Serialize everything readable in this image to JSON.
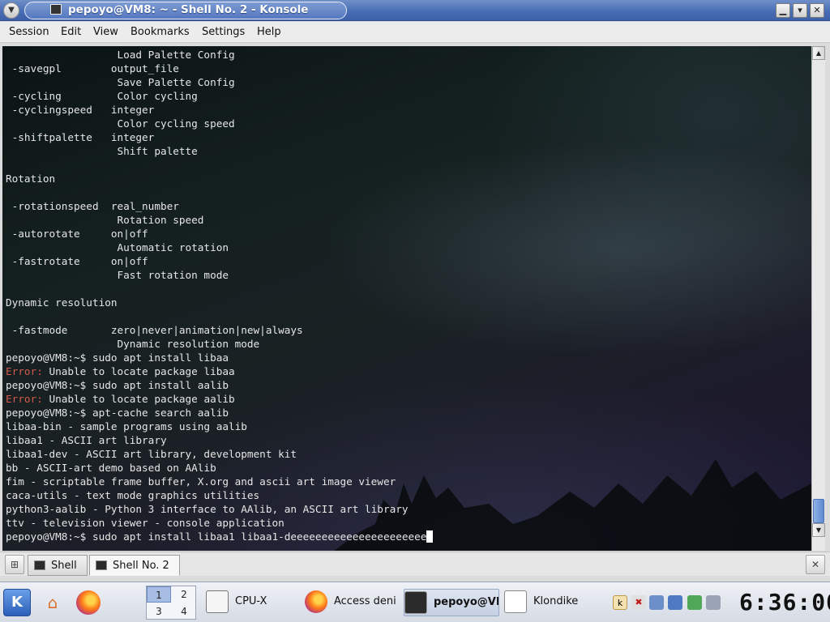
{
  "window": {
    "title": "pepoyo@VM8: ~ - Shell No. 2 - Konsole",
    "controls": {
      "minimize": "▁",
      "maximize": "▾",
      "close": "✕"
    }
  },
  "menubar": [
    "Session",
    "Edit",
    "View",
    "Bookmarks",
    "Settings",
    "Help"
  ],
  "terminal": {
    "lines": [
      {
        "text": "                  Load Palette Config"
      },
      {
        "text": " -savegpl        output_file"
      },
      {
        "text": "                  Save Palette Config"
      },
      {
        "text": " -cycling         Color cycling"
      },
      {
        "text": " -cyclingspeed   integer"
      },
      {
        "text": "                  Color cycling speed"
      },
      {
        "text": " -shiftpalette   integer"
      },
      {
        "text": "                  Shift palette"
      },
      {
        "text": ""
      },
      {
        "text": "Rotation"
      },
      {
        "text": ""
      },
      {
        "text": " -rotationspeed  real_number"
      },
      {
        "text": "                  Rotation speed"
      },
      {
        "text": " -autorotate     on|off"
      },
      {
        "text": "                  Automatic rotation"
      },
      {
        "text": " -fastrotate     on|off"
      },
      {
        "text": "                  Fast rotation mode"
      },
      {
        "text": ""
      },
      {
        "text": "Dynamic resolution"
      },
      {
        "text": ""
      },
      {
        "text": " -fastmode       zero|never|animation|new|always"
      },
      {
        "text": "                  Dynamic resolution mode"
      },
      {
        "text": "pepoyo@VM8:~$ sudo apt install libaa"
      },
      {
        "error": "Error:",
        "text": " Unable to locate package libaa"
      },
      {
        "text": "pepoyo@VM8:~$ sudo apt install aalib"
      },
      {
        "error": "Error:",
        "text": " Unable to locate package aalib"
      },
      {
        "text": "pepoyo@VM8:~$ apt-cache search aalib"
      },
      {
        "text": "libaa-bin - sample programs using aalib"
      },
      {
        "text": "libaa1 - ASCII art library"
      },
      {
        "text": "libaa1-dev - ASCII art library, development kit"
      },
      {
        "text": "bb - ASCII-art demo based on AAlib"
      },
      {
        "text": "fim - scriptable frame buffer, X.org and ascii art image viewer"
      },
      {
        "text": "caca-utils - text mode graphics utilities"
      },
      {
        "text": "python3-aalib - Python 3 interface to AAlib, an ASCII art library"
      },
      {
        "text": "ttv - television viewer - console application"
      },
      {
        "text": "pepoyo@VM8:~$ sudo apt install libaa1 libaa1-deeeeeeeeeeeeeeeeeeeeee",
        "cursor": true
      }
    ]
  },
  "scrollbar": {
    "up": "▲",
    "down": "▼"
  },
  "tabs": {
    "items": [
      {
        "label": "Shell",
        "active": false
      },
      {
        "label": "Shell No. 2",
        "active": true
      }
    ]
  },
  "taskbar": {
    "kmenu_label": "K",
    "pager": [
      "1",
      "2",
      "3",
      "4"
    ],
    "tasks": [
      {
        "label": "CPU-X",
        "active": false
      },
      {
        "label": "Access deni",
        "active": false
      },
      {
        "label": "pepoyo@VI",
        "active": true
      },
      {
        "label": "Klondike",
        "active": false
      }
    ],
    "clock": "6:36:00"
  },
  "colors": {
    "error": "#d15a4a",
    "titlebar": "#4a6eb6",
    "text": "#e6e6e6"
  }
}
